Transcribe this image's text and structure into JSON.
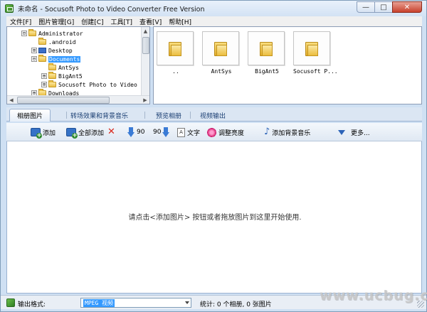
{
  "window": {
    "title": "未命名 - Socusoft Photo to Video Converter Free Version",
    "controls": {
      "minimize": "—",
      "maximize": "□",
      "close": "✕"
    }
  },
  "menu": [
    "文件[F]",
    "图片管理[G]",
    "创建[C]",
    "工具[T]",
    "查看[V]",
    "帮助[H]"
  ],
  "tree": {
    "items": [
      {
        "label": "Administrator",
        "icon": "folder-icon",
        "expander": "⊟",
        "selected": false
      },
      {
        "label": ".android",
        "icon": "folder-icon",
        "expander": "",
        "selected": false
      },
      {
        "label": "Desktop",
        "icon": "desktop-icon",
        "expander": "⊞",
        "selected": false
      },
      {
        "label": "Documents",
        "icon": "folder-icon",
        "expander": "⊟",
        "selected": true
      },
      {
        "label": "AntSys",
        "icon": "folder-icon",
        "expander": "",
        "selected": false
      },
      {
        "label": "BigAnt5",
        "icon": "folder-icon",
        "expander": "⊞",
        "selected": false
      },
      {
        "label": "Socusoft Photo to Video C",
        "icon": "folder-icon",
        "expander": "⊞",
        "selected": false
      },
      {
        "label": "Downloads",
        "icon": "folder-icon",
        "expander": "⊞",
        "selected": false
      }
    ]
  },
  "thumbnails": [
    {
      "label": "..",
      "icon": "folder-icon"
    },
    {
      "label": "AntSys",
      "icon": "folder-icon"
    },
    {
      "label": "BigAnt5",
      "icon": "folder-icon"
    },
    {
      "label": "Socusoft P...",
      "icon": "folder-icon"
    }
  ],
  "tabs": [
    {
      "label": "相册图片",
      "active": true
    },
    {
      "label": "转场效果和背景音乐",
      "active": false
    },
    {
      "label": "预览相册",
      "active": false
    },
    {
      "label": "视频输出",
      "active": false
    }
  ],
  "toolbar": {
    "add": "添加",
    "add_all": "全部添加",
    "rotate_left": "90",
    "rotate_right": "90",
    "text": "文字",
    "brightness": "调整亮度",
    "bg_music": "添加背景音乐",
    "more": "更多..."
  },
  "main": {
    "hint": "请点击<添加图片> 按钮或者拖放图片到这里开始使用."
  },
  "status": {
    "output_label": "输出格式:",
    "format_value": "MPEG 视频",
    "stats": "统计: 0 个相册, 0 张图片"
  },
  "watermark": "www.ucbug.cc",
  "colors": {
    "selection": "#3399ff",
    "tab_text": "#1b3f73",
    "delete_red": "#d8261a",
    "folder_yellow": "#e9bf44"
  }
}
